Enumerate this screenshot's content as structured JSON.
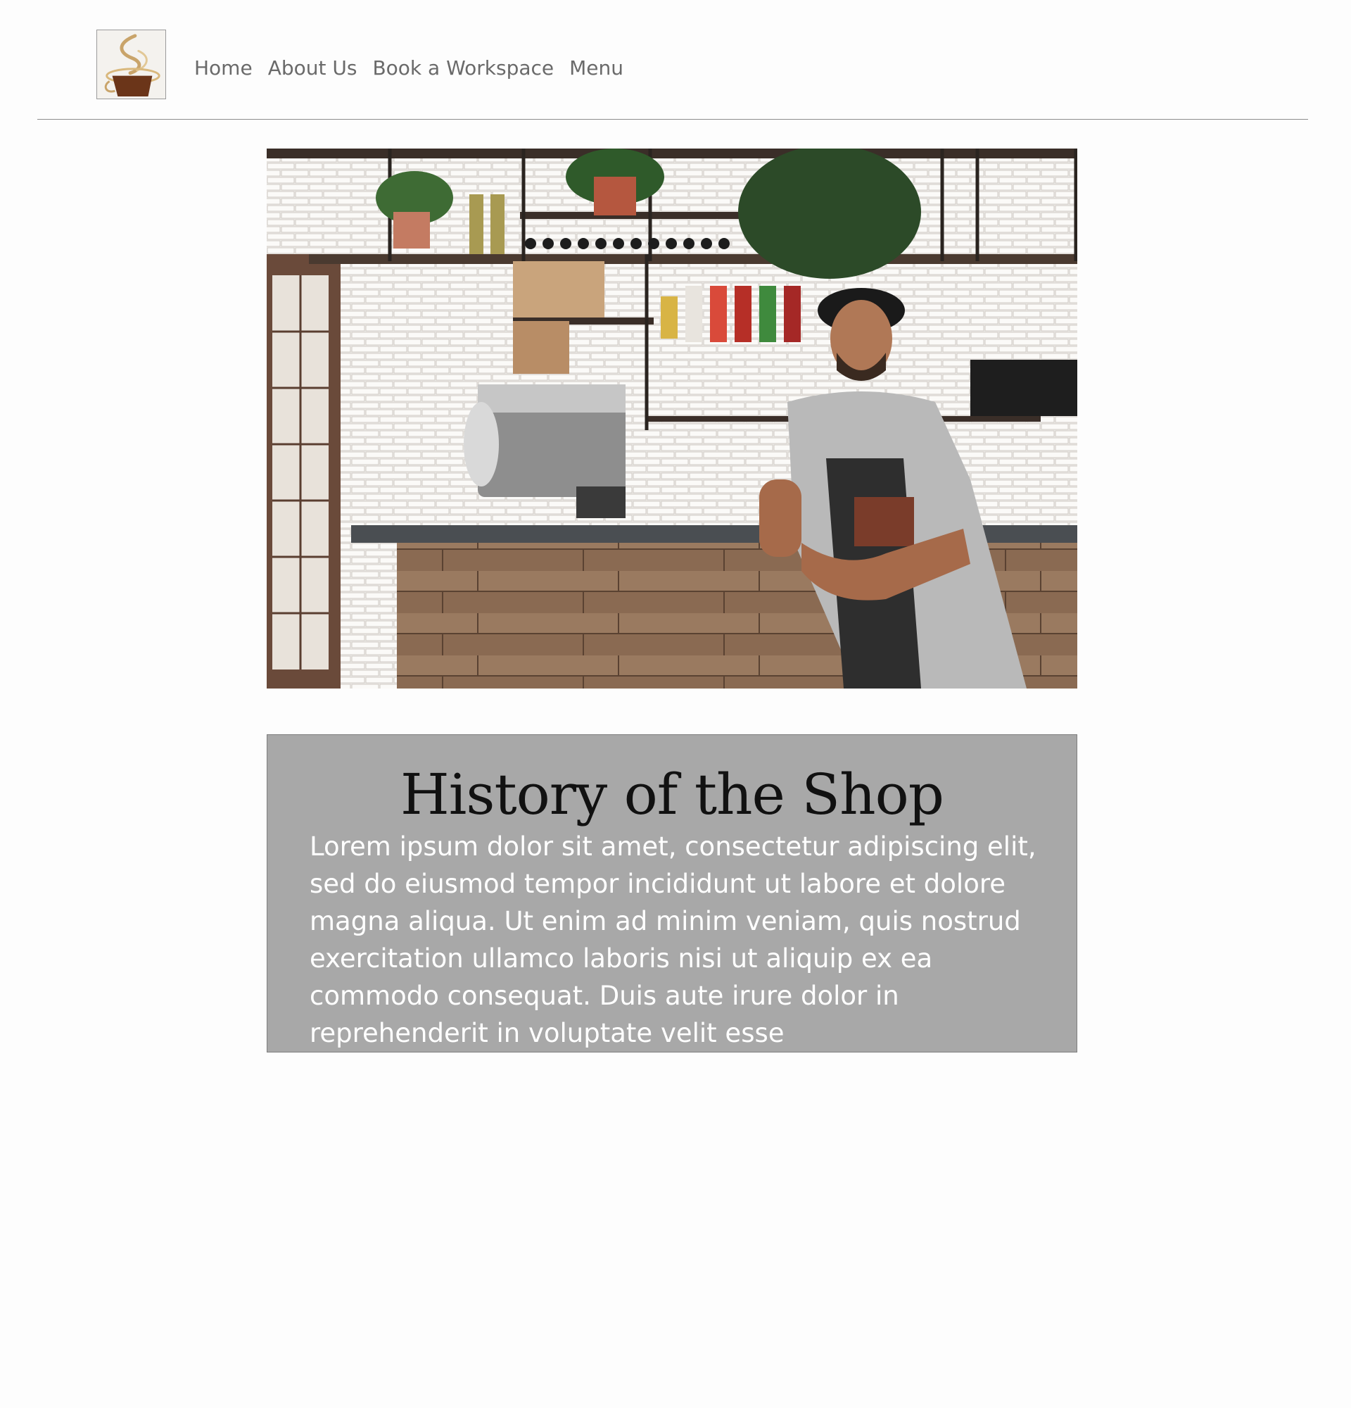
{
  "header": {
    "logo_icon": "coffee-cup-icon",
    "nav": [
      {
        "label": "Home"
      },
      {
        "label": "About Us"
      },
      {
        "label": "Book a Workspace"
      },
      {
        "label": "Menu"
      }
    ]
  },
  "history": {
    "title": "History of the Shop",
    "body": "Lorem ipsum dolor sit amet, consectetur adipiscing elit, sed do eiusmod tempor incididunt ut labore et dolore magna aliqua. Ut enim ad minim veniam, quis nostrud exercitation ullamco laboris nisi ut aliquip ex ea commodo consequat. Duis aute irure dolor in reprehenderit in voluptate velit esse"
  },
  "colors": {
    "panel_bg": "#a8a8a8",
    "nav_text": "#6a6a6a",
    "coffee_brown": "#6b3519",
    "steam_gold": "#c9a46a"
  }
}
